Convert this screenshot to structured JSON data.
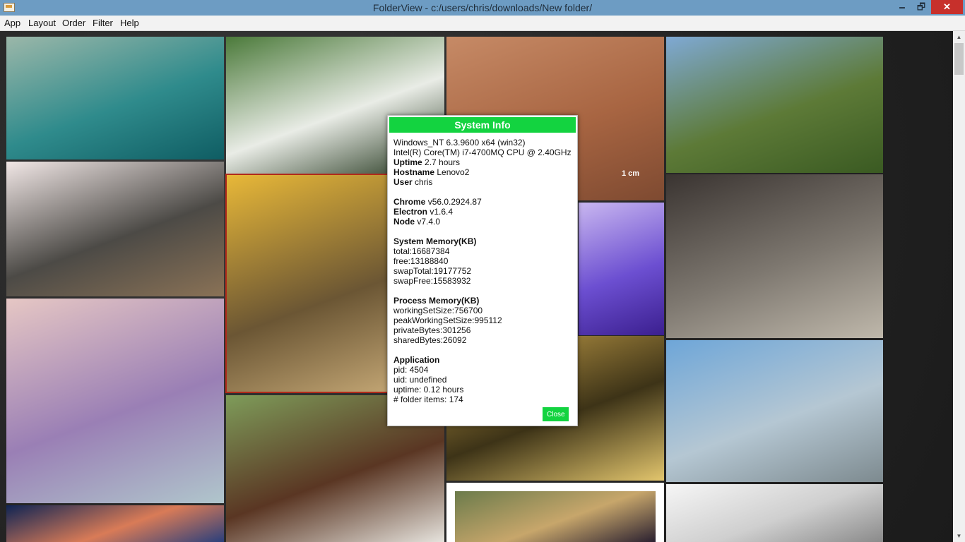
{
  "window": {
    "title": "FolderView - c:/users/chris/downloads/New folder/",
    "minimize": "🗕",
    "maximize": "🗗",
    "close": "✕"
  },
  "menu": [
    "App",
    "Layout",
    "Order",
    "Filter",
    "Help"
  ],
  "gallery": {
    "tiles": [
      {
        "name": "photo-bird-over-water",
        "colors": [
          "#9bb7a9",
          "#2f8b8c",
          "#0f5d63"
        ]
      },
      {
        "name": "photo-white-flowers",
        "colors": [
          "#4b7a3a",
          "#e9ece6",
          "#20331a"
        ]
      },
      {
        "name": "photo-mars-rock",
        "colors": [
          "#c68a66",
          "#a86542",
          "#7e4a31"
        ]
      },
      {
        "name": "photo-mountain-valley",
        "colors": [
          "#7fa9d4",
          "#5d7a37",
          "#3a5a22"
        ]
      },
      {
        "name": "photo-stone-sculpture",
        "colors": [
          "#f1e7e6",
          "#4c4a46",
          "#8a7256"
        ]
      },
      {
        "name": "photo-autumn-trees",
        "colors": [
          "#e8b838",
          "#6b5634",
          "#d0b27e"
        ]
      },
      {
        "name": "photo-purple-flower",
        "colors": [
          "#c9b7f0",
          "#6c4fd1",
          "#3b1f8f"
        ]
      },
      {
        "name": "photo-stone-jaguar",
        "colors": [
          "#3a3431",
          "#7e7870",
          "#bfb8ab"
        ]
      },
      {
        "name": "photo-crystal-egg",
        "colors": [
          "#e6c7c4",
          "#9a7fb5",
          "#b0c6cc"
        ]
      },
      {
        "name": "photo-lizard-eye",
        "colors": [
          "#c8a24a",
          "#3d3317",
          "#e2c56d"
        ]
      },
      {
        "name": "photo-beach-balloons",
        "colors": [
          "#6ea6d8",
          "#b5c7d3",
          "#7d8a8f"
        ]
      },
      {
        "name": "photo-face-paint",
        "colors": [
          "#7e9c5a",
          "#5a3623",
          "#e6e3dd"
        ]
      },
      {
        "name": "photo-night-sky",
        "colors": [
          "#0f2454",
          "#d97b57",
          "#2a3f7c"
        ]
      },
      {
        "name": "photo-abstract-painting",
        "colors": [
          "#6b7b4b",
          "#c7a66b",
          "#2a2030"
        ]
      },
      {
        "name": "photo-pencil-sketch",
        "colors": [
          "#f6f6f6",
          "#cfcfcf",
          "#8a8a8a"
        ]
      }
    ],
    "scale_label": "1 cm"
  },
  "dialog": {
    "title": "System Info",
    "os": "Windows_NT 6.3.9600 x64 (win32)",
    "cpu": "Intel(R) Core(TM) i7-4700MQ CPU @ 2.40GHz",
    "uptime_label": "Uptime",
    "uptime_value": "2.7 hours",
    "hostname_label": "Hostname",
    "hostname_value": "Lenovo2",
    "user_label": "User",
    "user_value": "chris",
    "chrome_label": "Chrome",
    "chrome_value": "v56.0.2924.87",
    "electron_label": "Electron",
    "electron_value": "v1.6.4",
    "node_label": "Node",
    "node_value": "v7.4.0",
    "sysmem_heading": "System Memory(KB)",
    "sysmem_total": "total:16687384",
    "sysmem_free": "free:13188840",
    "sysmem_swaptotal": "swapTotal:19177752",
    "sysmem_swapfree": "swapFree:15583932",
    "procmem_heading": "Process Memory(KB)",
    "procmem_working": "workingSetSize:756700",
    "procmem_peak": "peakWorkingSetSize:995112",
    "procmem_private": "privateBytes:301256",
    "procmem_shared": "sharedBytes:26092",
    "app_heading": "Application",
    "app_pid": "pid: 4504",
    "app_uid": "uid: undefined",
    "app_uptime": "uptime: 0.12 hours",
    "app_items": "# folder items: 174",
    "close_label": "Close"
  }
}
